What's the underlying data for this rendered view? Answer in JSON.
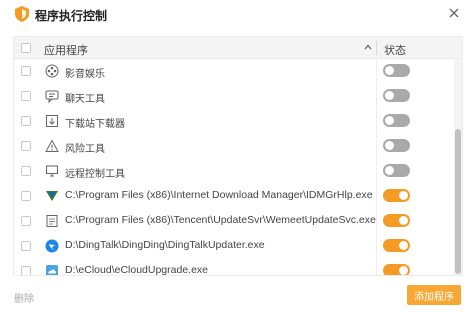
{
  "window": {
    "title": "程序执行控制",
    "close_icon": "close-icon",
    "logo_icon": "shield-logo-icon"
  },
  "table": {
    "col_app": "应用程序",
    "col_status": "状态",
    "rows": [
      {
        "label": "影音娱乐",
        "icon": "media-icon",
        "enabled": false
      },
      {
        "label": "聊天工具",
        "icon": "chat-icon",
        "enabled": false
      },
      {
        "label": "下载站下载器",
        "icon": "download-icon",
        "enabled": false
      },
      {
        "label": "风险工具",
        "icon": "warning-icon",
        "enabled": false
      },
      {
        "label": "远程控制工具",
        "icon": "remote-icon",
        "enabled": false
      },
      {
        "label": "C:\\Program Files (x86)\\Internet Download Manager\\IDMGrHlp.exe",
        "icon": "idm-icon",
        "enabled": true
      },
      {
        "label": "C:\\Program Files (x86)\\Tencent\\UpdateSvr\\WemeetUpdateSvc.exe",
        "icon": "generic-app-icon",
        "enabled": true
      },
      {
        "label": "D:\\DingTalk\\DingDing\\DingTalkUpdater.exe",
        "icon": "dingtalk-icon",
        "enabled": true
      },
      {
        "label": "D:\\eCloud\\eCloudUpgrade.exe",
        "icon": "ecloud-icon",
        "enabled": true
      }
    ]
  },
  "footer": {
    "delete_label": "删除",
    "add_label": "添加程序"
  },
  "colors": {
    "toggle_on": "#f59a23",
    "toggle_off": "#a9a9a9",
    "add_button": "#f7a733"
  }
}
